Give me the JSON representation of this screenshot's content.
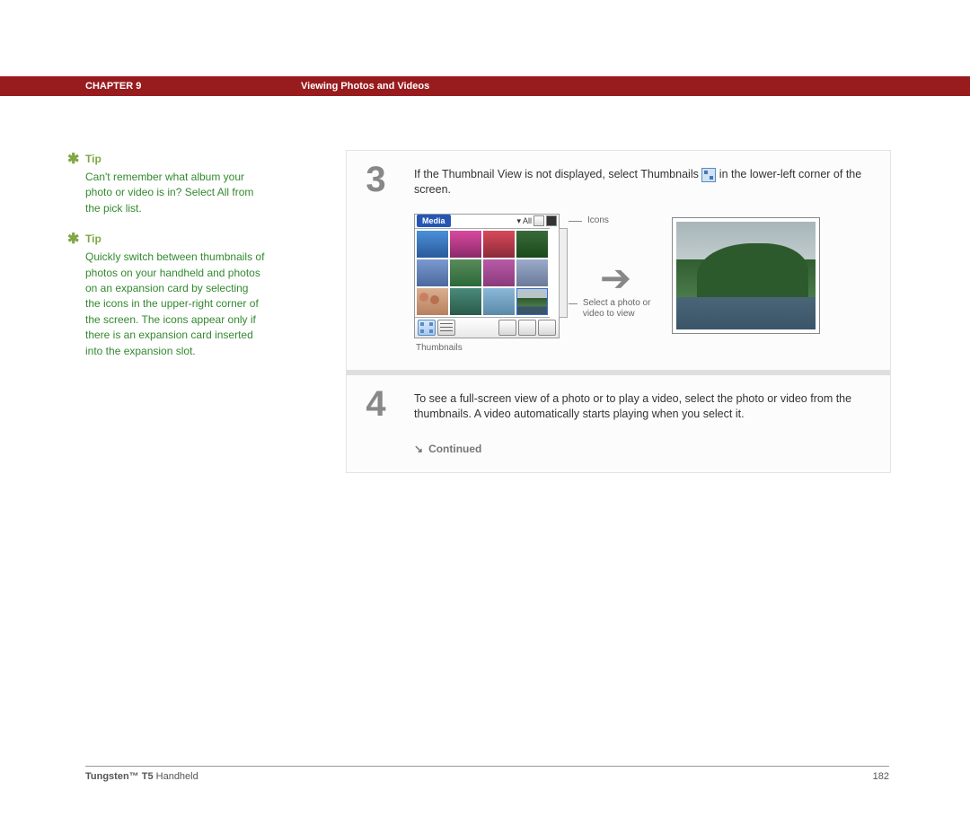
{
  "header": {
    "chapter": "CHAPTER 9",
    "title": "Viewing Photos and Videos"
  },
  "tips": [
    {
      "label": "Tip",
      "text": "Can't remember what album your photo or video is in? Select All from the pick list."
    },
    {
      "label": "Tip",
      "text": "Quickly switch between thumbnails of photos on your handheld and photos on an expansion card by selecting the icons in the upper-right corner of the screen. The icons appear only if there is an expansion card inserted into the expansion slot."
    }
  ],
  "steps": {
    "s3": {
      "number": "3",
      "text_a": "If the Thumbnail View is not displayed, select Thumbnails ",
      "text_b": " in the lower-left corner of the screen.",
      "palm": {
        "app_label": "Media",
        "picklist": "All"
      },
      "labels": {
        "icons": "Icons",
        "select": "Select a photo or video to view",
        "thumbnails": "Thumbnails"
      }
    },
    "s4": {
      "number": "4",
      "text": "To see a full-screen view of a photo or to play a video, select the photo or video from the thumbnails. A video automatically starts playing when you select it.",
      "continued": "Continued"
    }
  },
  "footer": {
    "product_bold": "Tungsten™ T5",
    "product_rest": " Handheld",
    "page": "182"
  }
}
